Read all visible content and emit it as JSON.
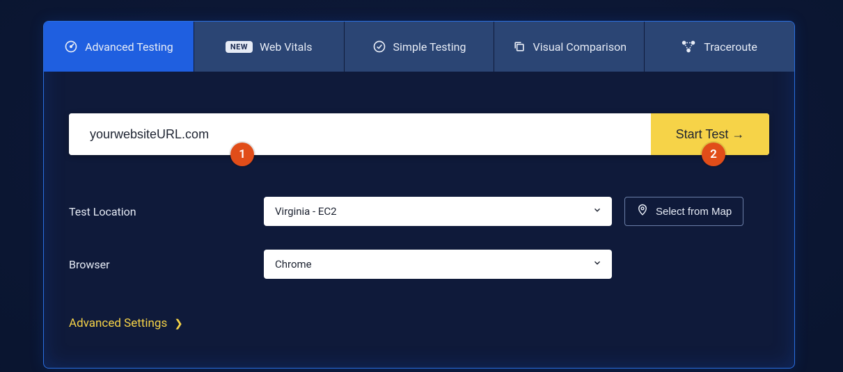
{
  "tabs": {
    "advanced": {
      "label": "Advanced Testing"
    },
    "webvitals": {
      "badge": "NEW",
      "label": "Web Vitals"
    },
    "simple": {
      "label": "Simple Testing"
    },
    "visual": {
      "label": "Visual Comparison"
    },
    "traceroute": {
      "label": "Traceroute"
    }
  },
  "url_row": {
    "placeholder": "yourwebsiteURL.com",
    "start_label": "Start Test →"
  },
  "form": {
    "location_label": "Test Location",
    "location_value": "Virginia - EC2",
    "select_map_label": "Select from Map",
    "browser_label": "Browser",
    "browser_value": "Chrome"
  },
  "advanced_link": {
    "label": "Advanced Settings"
  },
  "annotations": {
    "a1": "1",
    "a2": "2"
  }
}
